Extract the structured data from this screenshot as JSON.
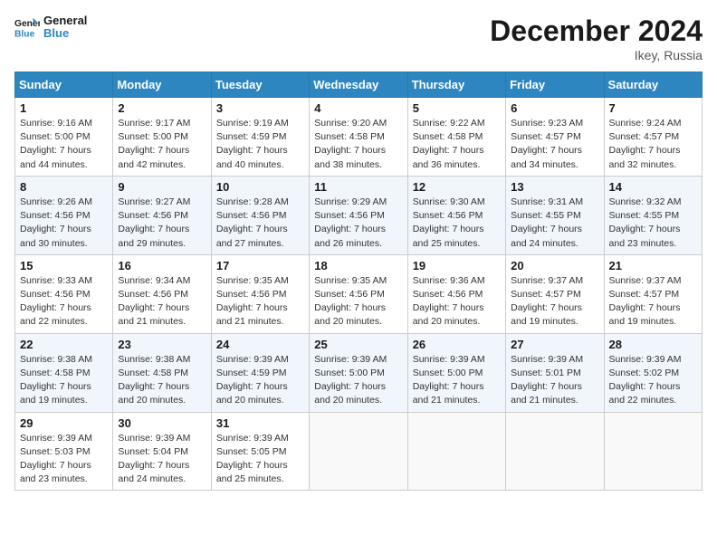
{
  "logo": {
    "general": "General",
    "blue": "Blue"
  },
  "header": {
    "month": "December 2024",
    "location": "Ikey, Russia"
  },
  "weekdays": [
    "Sunday",
    "Monday",
    "Tuesday",
    "Wednesday",
    "Thursday",
    "Friday",
    "Saturday"
  ],
  "weeks": [
    [
      {
        "day": "1",
        "sunrise": "Sunrise: 9:16 AM",
        "sunset": "Sunset: 5:00 PM",
        "daylight": "Daylight: 7 hours and 44 minutes."
      },
      {
        "day": "2",
        "sunrise": "Sunrise: 9:17 AM",
        "sunset": "Sunset: 5:00 PM",
        "daylight": "Daylight: 7 hours and 42 minutes."
      },
      {
        "day": "3",
        "sunrise": "Sunrise: 9:19 AM",
        "sunset": "Sunset: 4:59 PM",
        "daylight": "Daylight: 7 hours and 40 minutes."
      },
      {
        "day": "4",
        "sunrise": "Sunrise: 9:20 AM",
        "sunset": "Sunset: 4:58 PM",
        "daylight": "Daylight: 7 hours and 38 minutes."
      },
      {
        "day": "5",
        "sunrise": "Sunrise: 9:22 AM",
        "sunset": "Sunset: 4:58 PM",
        "daylight": "Daylight: 7 hours and 36 minutes."
      },
      {
        "day": "6",
        "sunrise": "Sunrise: 9:23 AM",
        "sunset": "Sunset: 4:57 PM",
        "daylight": "Daylight: 7 hours and 34 minutes."
      },
      {
        "day": "7",
        "sunrise": "Sunrise: 9:24 AM",
        "sunset": "Sunset: 4:57 PM",
        "daylight": "Daylight: 7 hours and 32 minutes."
      }
    ],
    [
      {
        "day": "8",
        "sunrise": "Sunrise: 9:26 AM",
        "sunset": "Sunset: 4:56 PM",
        "daylight": "Daylight: 7 hours and 30 minutes."
      },
      {
        "day": "9",
        "sunrise": "Sunrise: 9:27 AM",
        "sunset": "Sunset: 4:56 PM",
        "daylight": "Daylight: 7 hours and 29 minutes."
      },
      {
        "day": "10",
        "sunrise": "Sunrise: 9:28 AM",
        "sunset": "Sunset: 4:56 PM",
        "daylight": "Daylight: 7 hours and 27 minutes."
      },
      {
        "day": "11",
        "sunrise": "Sunrise: 9:29 AM",
        "sunset": "Sunset: 4:56 PM",
        "daylight": "Daylight: 7 hours and 26 minutes."
      },
      {
        "day": "12",
        "sunrise": "Sunrise: 9:30 AM",
        "sunset": "Sunset: 4:56 PM",
        "daylight": "Daylight: 7 hours and 25 minutes."
      },
      {
        "day": "13",
        "sunrise": "Sunrise: 9:31 AM",
        "sunset": "Sunset: 4:55 PM",
        "daylight": "Daylight: 7 hours and 24 minutes."
      },
      {
        "day": "14",
        "sunrise": "Sunrise: 9:32 AM",
        "sunset": "Sunset: 4:55 PM",
        "daylight": "Daylight: 7 hours and 23 minutes."
      }
    ],
    [
      {
        "day": "15",
        "sunrise": "Sunrise: 9:33 AM",
        "sunset": "Sunset: 4:56 PM",
        "daylight": "Daylight: 7 hours and 22 minutes."
      },
      {
        "day": "16",
        "sunrise": "Sunrise: 9:34 AM",
        "sunset": "Sunset: 4:56 PM",
        "daylight": "Daylight: 7 hours and 21 minutes."
      },
      {
        "day": "17",
        "sunrise": "Sunrise: 9:35 AM",
        "sunset": "Sunset: 4:56 PM",
        "daylight": "Daylight: 7 hours and 21 minutes."
      },
      {
        "day": "18",
        "sunrise": "Sunrise: 9:35 AM",
        "sunset": "Sunset: 4:56 PM",
        "daylight": "Daylight: 7 hours and 20 minutes."
      },
      {
        "day": "19",
        "sunrise": "Sunrise: 9:36 AM",
        "sunset": "Sunset: 4:56 PM",
        "daylight": "Daylight: 7 hours and 20 minutes."
      },
      {
        "day": "20",
        "sunrise": "Sunrise: 9:37 AM",
        "sunset": "Sunset: 4:57 PM",
        "daylight": "Daylight: 7 hours and 19 minutes."
      },
      {
        "day": "21",
        "sunrise": "Sunrise: 9:37 AM",
        "sunset": "Sunset: 4:57 PM",
        "daylight": "Daylight: 7 hours and 19 minutes."
      }
    ],
    [
      {
        "day": "22",
        "sunrise": "Sunrise: 9:38 AM",
        "sunset": "Sunset: 4:58 PM",
        "daylight": "Daylight: 7 hours and 19 minutes."
      },
      {
        "day": "23",
        "sunrise": "Sunrise: 9:38 AM",
        "sunset": "Sunset: 4:58 PM",
        "daylight": "Daylight: 7 hours and 20 minutes."
      },
      {
        "day": "24",
        "sunrise": "Sunrise: 9:39 AM",
        "sunset": "Sunset: 4:59 PM",
        "daylight": "Daylight: 7 hours and 20 minutes."
      },
      {
        "day": "25",
        "sunrise": "Sunrise: 9:39 AM",
        "sunset": "Sunset: 5:00 PM",
        "daylight": "Daylight: 7 hours and 20 minutes."
      },
      {
        "day": "26",
        "sunrise": "Sunrise: 9:39 AM",
        "sunset": "Sunset: 5:00 PM",
        "daylight": "Daylight: 7 hours and 21 minutes."
      },
      {
        "day": "27",
        "sunrise": "Sunrise: 9:39 AM",
        "sunset": "Sunset: 5:01 PM",
        "daylight": "Daylight: 7 hours and 21 minutes."
      },
      {
        "day": "28",
        "sunrise": "Sunrise: 9:39 AM",
        "sunset": "Sunset: 5:02 PM",
        "daylight": "Daylight: 7 hours and 22 minutes."
      }
    ],
    [
      {
        "day": "29",
        "sunrise": "Sunrise: 9:39 AM",
        "sunset": "Sunset: 5:03 PM",
        "daylight": "Daylight: 7 hours and 23 minutes."
      },
      {
        "day": "30",
        "sunrise": "Sunrise: 9:39 AM",
        "sunset": "Sunset: 5:04 PM",
        "daylight": "Daylight: 7 hours and 24 minutes."
      },
      {
        "day": "31",
        "sunrise": "Sunrise: 9:39 AM",
        "sunset": "Sunset: 5:05 PM",
        "daylight": "Daylight: 7 hours and 25 minutes."
      },
      null,
      null,
      null,
      null
    ]
  ]
}
